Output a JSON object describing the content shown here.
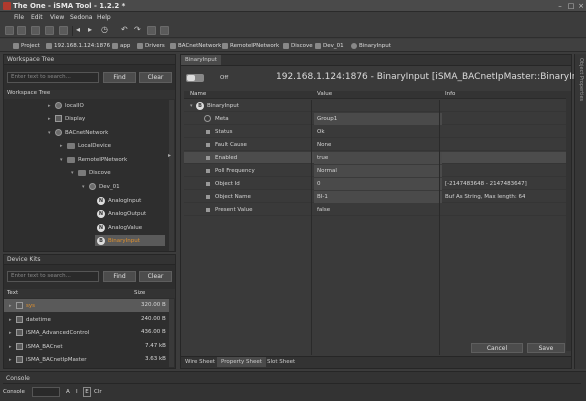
{
  "window": {
    "title": "The One - iSMA Tool - 1.2.2 *"
  },
  "menu": [
    "File",
    "Edit",
    "View",
    "Sedona",
    "Help"
  ],
  "breadcrumb": [
    "Project",
    "192.168.1.124:1876",
    "app",
    "Drivers",
    "BACnetNetwork",
    "RemoteIPNetwork",
    "Discove",
    "Dev_01",
    "BinaryInput"
  ],
  "workspace": {
    "title": "Workspace Tree",
    "search_placeholder": "Enter text to search...",
    "find_label": "Find",
    "clear_label": "Clear",
    "tree_label": "Workspace Tree",
    "nodes": [
      {
        "label": "localIO"
      },
      {
        "label": "Display"
      },
      {
        "label": "BACnetNetwork"
      },
      {
        "label": "LocalDevice"
      },
      {
        "label": "RemoteIPNetwork"
      },
      {
        "label": "Discove"
      },
      {
        "label": "Dev_01"
      },
      {
        "label": "AnalogInput"
      },
      {
        "label": "AnalogOutput"
      },
      {
        "label": "AnalogValue"
      },
      {
        "label": "BinaryInput"
      }
    ]
  },
  "kits": {
    "title": "Device Kits",
    "search_placeholder": "Enter text to search...",
    "find_label": "Find",
    "clear_label": "Clear",
    "col_text": "Text",
    "col_size": "Size",
    "rows": [
      {
        "name": "sys",
        "size": "320.00 B"
      },
      {
        "name": "datetime",
        "size": "240.00 B"
      },
      {
        "name": "iSMA_AdvancedControl",
        "size": "436.00 B"
      },
      {
        "name": "iSMA_BACnet",
        "size": "7.47 kB"
      },
      {
        "name": "iSMA_BACnetIpMaster",
        "size": "3.63 kB"
      }
    ]
  },
  "editor": {
    "tab": "BinaryInput",
    "toggle_label": "Off",
    "header": "192.168.1.124:1876 - BinaryInput [iSMA_BACnetIpMaster::BinaryInput]",
    "col_name": "Name",
    "col_value": "Value",
    "col_info": "Info",
    "root": "BinaryInput",
    "rows": [
      {
        "name": "Meta",
        "value": "Group1",
        "info": ""
      },
      {
        "name": "Status",
        "value": "Ok",
        "info": ""
      },
      {
        "name": "Fault Cause",
        "value": "None",
        "info": ""
      },
      {
        "name": "Enabled",
        "value": "true",
        "info": ""
      },
      {
        "name": "Poll Frequency",
        "value": "Normal",
        "info": ""
      },
      {
        "name": "Object Id",
        "value": "0",
        "info": "[-2147483648 - 2147483647]"
      },
      {
        "name": "Object Name",
        "value": "BI-1",
        "info": "Buf As String, Max length: 64"
      },
      {
        "name": "Present Value",
        "value": "false",
        "info": ""
      }
    ],
    "cancel_label": "Cancel",
    "save_label": "Save",
    "bottom_tabs": [
      "Wire Sheet",
      "Property Sheet",
      "Slot Sheet"
    ]
  },
  "right_strip": "Object Properties",
  "console": {
    "title": "Console",
    "label": "Console",
    "buttons": [
      "A",
      "I",
      "E",
      "Clr"
    ]
  },
  "colors": {
    "accent": "#e0912e",
    "background": "#3c3c3c"
  }
}
